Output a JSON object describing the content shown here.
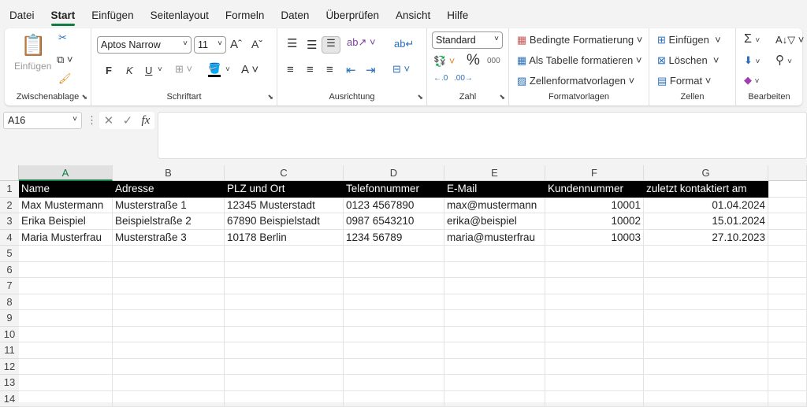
{
  "menu": [
    "Datei",
    "Start",
    "Einfügen",
    "Seitenlayout",
    "Formeln",
    "Daten",
    "Überprüfen",
    "Ansicht",
    "Hilfe"
  ],
  "ribbon": {
    "clipboard": {
      "paste": "Einfügen",
      "label": "Zwischenablage"
    },
    "font": {
      "name": "Aptos Narrow",
      "size": "11",
      "bold": "F",
      "italic": "K",
      "underline": "U",
      "label": "Schriftart"
    },
    "alignment": {
      "label": "Ausrichtung"
    },
    "number": {
      "format": "Standard",
      "percent": "%",
      "thousands": "000",
      "label": "Zahl"
    },
    "styles": {
      "conditional": "Bedingte Formatierung",
      "as_table": "Als Tabelle formatieren",
      "cell_styles": "Zellenformatvorlagen",
      "label": "Formatvorlagen"
    },
    "cells": {
      "insert": "Einfügen",
      "delete": "Löschen",
      "format": "Format",
      "label": "Zellen"
    },
    "editing": {
      "label": "Bearbeiten"
    }
  },
  "formula_bar": {
    "name_box": "A16",
    "fx": "fx",
    "value": ""
  },
  "sheet": {
    "columns": [
      "A",
      "B",
      "C",
      "D",
      "E",
      "F",
      "G",
      ""
    ],
    "row_numbers": [
      "1",
      "2",
      "3",
      "4",
      "5",
      "6",
      "7",
      "8",
      "9",
      "10",
      "11",
      "12",
      "13",
      "14"
    ],
    "header": [
      "Name",
      "Adresse",
      "PLZ und Ort",
      "Telefonnummer",
      "E-Mail",
      "Kundennummer",
      "zuletzt kontaktiert am"
    ],
    "rows": [
      [
        "Max Mustermann",
        "Musterstraße 1",
        "12345 Musterstadt",
        "0123 4567890",
        "max@mustermann",
        "10001",
        "01.04.2024"
      ],
      [
        "Erika Beispiel",
        "Beispielstraße 2",
        "67890 Beispielstadt",
        "0987 6543210",
        "erika@beispiel",
        "10002",
        "15.01.2024"
      ],
      [
        "Maria Musterfrau",
        "Musterstraße 3",
        "10178 Berlin",
        "1234 56789",
        "maria@musterfrau",
        "10003",
        "27.10.2023"
      ]
    ]
  }
}
